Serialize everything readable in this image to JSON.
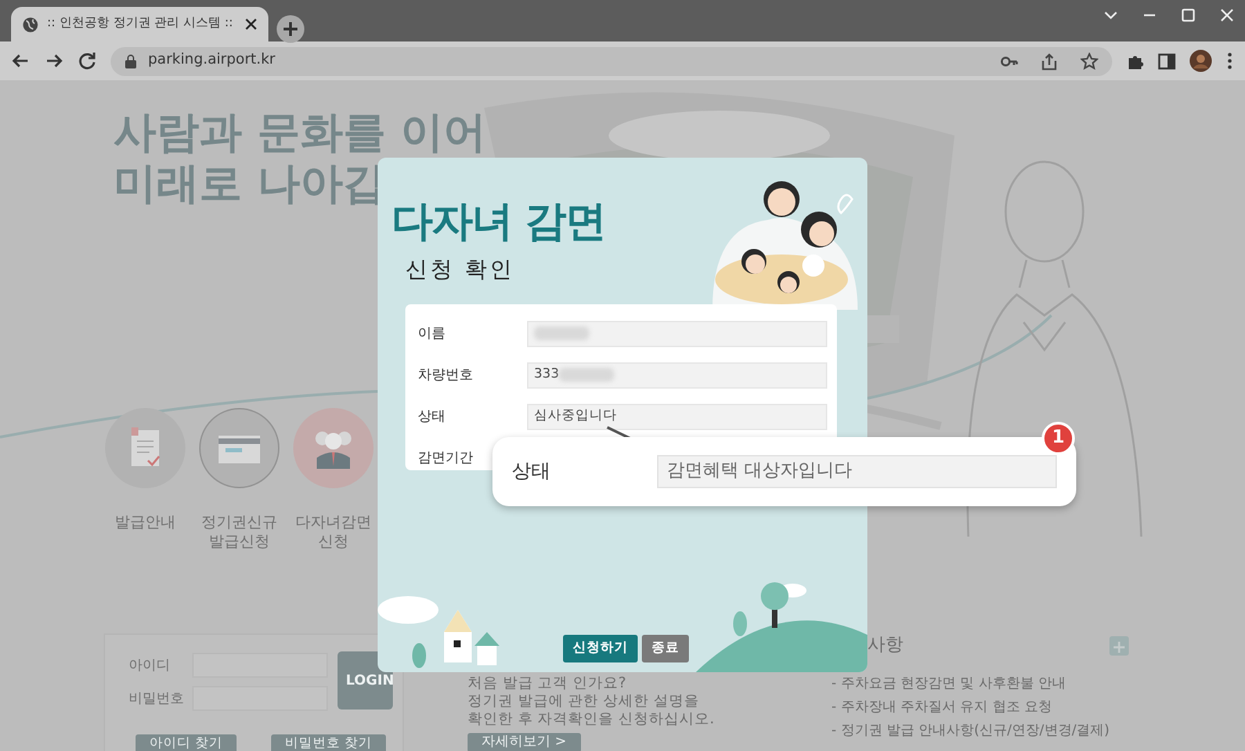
{
  "browser": {
    "tabs": [
      {
        "title": ":: 인천공항 정기권 관리 시스템 ::",
        "selected": true
      }
    ],
    "url": "parking.airport.kr"
  },
  "page": {
    "headline": [
      "사람과 문화를 이어",
      "미래로 나아갑"
    ],
    "menu": [
      {
        "kind": "document",
        "lines": [
          "발급안내"
        ]
      },
      {
        "kind": "card",
        "lines": [
          "정기권신규",
          "발급신청"
        ]
      },
      {
        "kind": "people",
        "lines": [
          "다자녀감면",
          "신청"
        ]
      }
    ],
    "login": {
      "fields": [
        {
          "label": "아이디"
        },
        {
          "label": "비밀번호"
        }
      ],
      "button": "LOGIN",
      "links": [
        "아이디 찾기",
        "비밀번호 찾기"
      ]
    },
    "guide": {
      "lines": [
        "처음 발급 고객 인가요?",
        "정기권 발급에 관한 상세한 설명을",
        "확인한 후 자격확인을 신청하십시오."
      ],
      "button": "자세히보기 >"
    },
    "notice": {
      "title": "사항",
      "items": [
        "- 주차요금 현장감면 및 사후환불 안내",
        "- 주차장내 주차질서 유지 협조 요청",
        "- 정기권 발급 안내사항(신규/연장/변경/결제)"
      ]
    }
  },
  "modal": {
    "title": "다자녀 감면",
    "subtitle": "신청 확인",
    "rows": [
      {
        "label": "이름",
        "blurred": true
      },
      {
        "label": "차량번호",
        "value": "333",
        "blurred": true
      },
      {
        "label": "상태",
        "value": "심사중입니다",
        "blurred": false
      },
      {
        "label": "감면기간"
      }
    ],
    "buttons": [
      {
        "label": "신청하기",
        "kind": "primary"
      },
      {
        "label": "종료",
        "kind": "secondary"
      }
    ]
  },
  "callout": {
    "label": "상태",
    "value": "감면혜택 대상자입니다",
    "badge": "1"
  }
}
